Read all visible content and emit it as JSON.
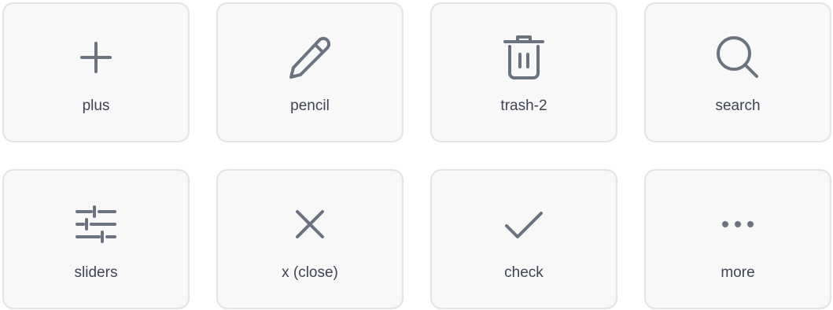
{
  "colors": {
    "icon_stroke": "#6b7280",
    "label_text": "#3f4452",
    "tile_background": "#f8f8f9",
    "tile_border": "#e4e4e7"
  },
  "tiles": [
    {
      "icon": "plus-icon",
      "label": "plus"
    },
    {
      "icon": "pencil-icon",
      "label": "pencil"
    },
    {
      "icon": "trash-icon",
      "label": "trash-2"
    },
    {
      "icon": "search-icon",
      "label": "search"
    },
    {
      "icon": "sliders-icon",
      "label": "sliders"
    },
    {
      "icon": "close-icon",
      "label": "x (close)"
    },
    {
      "icon": "check-icon",
      "label": "check"
    },
    {
      "icon": "more-icon",
      "label": "more"
    }
  ]
}
